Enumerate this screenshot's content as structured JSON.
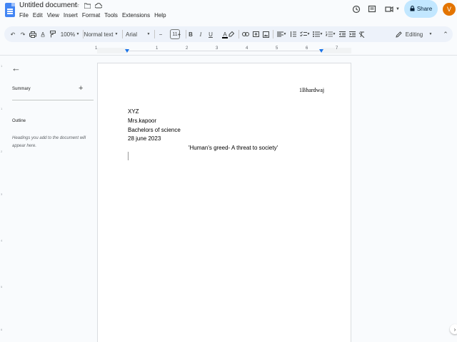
{
  "app": {
    "doc_title": "Untitled document",
    "menu": [
      "File",
      "Edit",
      "View",
      "Insert",
      "Format",
      "Tools",
      "Extensions",
      "Help"
    ],
    "share_label": "Share",
    "avatar_initial": "V"
  },
  "toolbar": {
    "zoom": "100%",
    "style": "Normal text",
    "font": "Arial",
    "font_size": "11",
    "bold": "B",
    "italic": "I",
    "underline": "U",
    "text_color": "A",
    "minus": "−",
    "plus": "+",
    "mode": "Editing"
  },
  "ruler": {
    "numbers": [
      "1",
      "1",
      "2",
      "3",
      "4",
      "5",
      "6",
      "7"
    ]
  },
  "sidebar": {
    "summary_label": "Summary",
    "summary_add": "+",
    "outline_label": "Outline",
    "outline_hint": "Headings you add to the document will appear here."
  },
  "document": {
    "header_name": "1Bhardwaj",
    "lines": [
      "XYZ",
      "Mrs.kapoor",
      "Bachelors of science",
      "28 june 2023"
    ],
    "title": "'Human's greed- A threat to society'"
  },
  "colors": {
    "accent": "#1a73e8",
    "share_bg": "#c2e7ff",
    "avatar_bg": "#e37400",
    "toolbar_bg": "#edf2fa"
  }
}
